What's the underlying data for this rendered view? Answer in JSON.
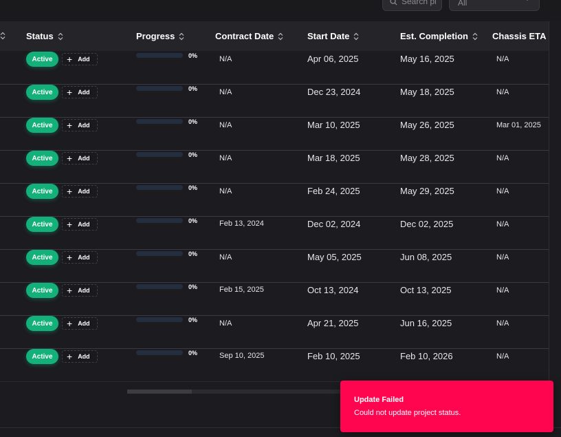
{
  "toolbar": {
    "search_placeholder": "Search pr",
    "filter_value": "All"
  },
  "columns": [
    {
      "key": "status",
      "label": "Status"
    },
    {
      "key": "progress",
      "label": "Progress"
    },
    {
      "key": "contract_date",
      "label": "Contract Date"
    },
    {
      "key": "start_date",
      "label": "Start Date"
    },
    {
      "key": "est_completion",
      "label": "Est. Completion"
    },
    {
      "key": "chassis_eta",
      "label": "Chassis ETA"
    }
  ],
  "add_label": "Add",
  "rows": [
    {
      "status": "Active",
      "progress": 0,
      "progress_label": "0%",
      "contract_date": "N/A",
      "start_date": "Apr 06, 2025",
      "est_completion": "May 16, 2025",
      "chassis_eta": "N/A"
    },
    {
      "status": "Active",
      "progress": 0,
      "progress_label": "0%",
      "contract_date": "N/A",
      "start_date": "Dec 23, 2024",
      "est_completion": "May 18, 2025",
      "chassis_eta": "N/A"
    },
    {
      "status": "Active",
      "progress": 0,
      "progress_label": "0%",
      "contract_date": "N/A",
      "start_date": "Mar 10, 2025",
      "est_completion": "May 26, 2025",
      "chassis_eta": "Mar 01, 2025"
    },
    {
      "status": "Active",
      "progress": 0,
      "progress_label": "0%",
      "contract_date": "N/A",
      "start_date": "Mar 18, 2025",
      "est_completion": "May 28, 2025",
      "chassis_eta": "N/A"
    },
    {
      "status": "Active",
      "progress": 0,
      "progress_label": "0%",
      "contract_date": "N/A",
      "start_date": "Feb 24, 2025",
      "est_completion": "May 29, 2025",
      "chassis_eta": "N/A"
    },
    {
      "status": "Active",
      "progress": 0,
      "progress_label": "0%",
      "contract_date": "Feb 13, 2024",
      "start_date": "Dec 02, 2024",
      "est_completion": "Dec 02, 2025",
      "chassis_eta": "N/A"
    },
    {
      "status": "Active",
      "progress": 0,
      "progress_label": "0%",
      "contract_date": "N/A",
      "start_date": "May 05, 2025",
      "est_completion": "Jun 08, 2025",
      "chassis_eta": "N/A"
    },
    {
      "status": "Active",
      "progress": 0,
      "progress_label": "0%",
      "contract_date": "Feb 15, 2025",
      "start_date": "Oct 13, 2024",
      "est_completion": "Oct 13, 2025",
      "chassis_eta": "N/A"
    },
    {
      "status": "Active",
      "progress": 0,
      "progress_label": "0%",
      "contract_date": "N/A",
      "start_date": "Apr 21, 2025",
      "est_completion": "Jun 16, 2025",
      "chassis_eta": "N/A"
    },
    {
      "status": "Active",
      "progress": 0,
      "progress_label": "0%",
      "contract_date": "Sep 10, 2025",
      "start_date": "Feb 10, 2025",
      "est_completion": "Feb 10, 2026",
      "chassis_eta": "N/A"
    }
  ],
  "toast": {
    "title": "Update Failed",
    "message": "Could not update project status."
  },
  "colors": {
    "status_active": "#14b07a",
    "toast_error": "#ff0550",
    "progress_track": "#232e3e"
  }
}
